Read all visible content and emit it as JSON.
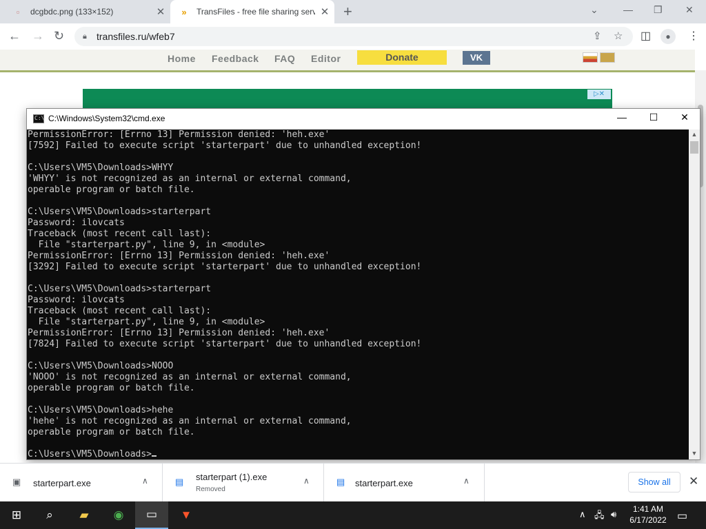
{
  "browser": {
    "tabs": [
      {
        "title": "dcgbdc.png (133×152)",
        "active": false
      },
      {
        "title": "TransFiles - free file sharing servi",
        "active": true
      }
    ],
    "url": "transfiles.ru/wfeb7"
  },
  "site": {
    "nav": [
      "Home",
      "Feedback",
      "FAQ",
      "Editor"
    ],
    "donate": "Donate",
    "vk": "VK",
    "ad_badge": "▷✕"
  },
  "cmd": {
    "title": "C:\\Windows\\System32\\cmd.exe",
    "lines": [
      "PermissionError: [Errno 13] Permission denied: 'heh.exe'",
      "[7592] Failed to execute script 'starterpart' due to unhandled exception!",
      "",
      "C:\\Users\\VM5\\Downloads>WHYY",
      "'WHYY' is not recognized as an internal or external command,",
      "operable program or batch file.",
      "",
      "C:\\Users\\VM5\\Downloads>starterpart",
      "Password: ilovcats",
      "Traceback (most recent call last):",
      "  File \"starterpart.py\", line 9, in <module>",
      "PermissionError: [Errno 13] Permission denied: 'heh.exe'",
      "[3292] Failed to execute script 'starterpart' due to unhandled exception!",
      "",
      "C:\\Users\\VM5\\Downloads>starterpart",
      "Password: ilovcats",
      "Traceback (most recent call last):",
      "  File \"starterpart.py\", line 9, in <module>",
      "PermissionError: [Errno 13] Permission denied: 'heh.exe'",
      "[7824] Failed to execute script 'starterpart' due to unhandled exception!",
      "",
      "C:\\Users\\VM5\\Downloads>NOOO",
      "'NOOO' is not recognized as an internal or external command,",
      "operable program or batch file.",
      "",
      "C:\\Users\\VM5\\Downloads>hehe",
      "'hehe' is not recognized as an internal or external command,",
      "operable program or batch file.",
      ""
    ],
    "prompt": "C:\\Users\\VM5\\Downloads>"
  },
  "downloads": {
    "items": [
      {
        "name": "starterpart.exe",
        "status": ""
      },
      {
        "name": "starterpart (1).exe",
        "status": "Removed"
      },
      {
        "name": "starterpart.exe",
        "status": ""
      }
    ],
    "show_all": "Show all"
  },
  "taskbar": {
    "time": "1:41 AM",
    "date": "6/17/2022"
  }
}
